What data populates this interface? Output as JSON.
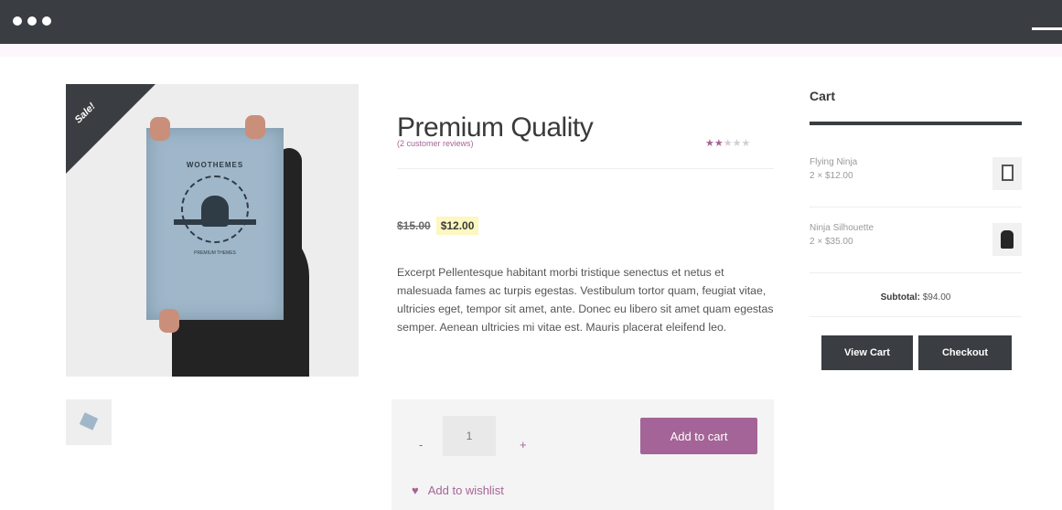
{
  "product": {
    "sale_badge": "Sale!",
    "title": "Premium Quality",
    "reviews": "(2 customer reviews)",
    "rating": 2,
    "rating_max": 5,
    "price_old": "$15.00",
    "price_new": "$12.00",
    "description": "Excerpt Pellentesque habitant morbi tristique senectus et netus et malesuada fames ac turpis egestas. Vestibulum tortor quam, feugiat vitae, ultricies eget, tempor sit amet, ante. Donec eu libero sit amet quam egestas semper. Aenean ultricies mi vitae est. Mauris placerat eleifend leo.",
    "poster_brand": "WOOTHEMES",
    "poster_tagline": "PREMIUM THEMES"
  },
  "cart_form": {
    "minus": "-",
    "quantity": "1",
    "plus": "+",
    "add_to_cart": "Add to cart",
    "wishlist": "Add to wishlist"
  },
  "cart": {
    "title": "Cart",
    "items": [
      {
        "name": "Flying Ninja",
        "qty_price": "2 × $12.00"
      },
      {
        "name": "Ninja Silhouette",
        "qty_price": "2 × $35.00"
      }
    ],
    "subtotal_label": "Subtotal:",
    "subtotal_value": "$94.00",
    "view_cart": "View Cart",
    "checkout": "Checkout"
  },
  "colors": {
    "accent": "#a46497",
    "dark": "#3a3d41",
    "price_highlight": "#fdf7c0"
  }
}
